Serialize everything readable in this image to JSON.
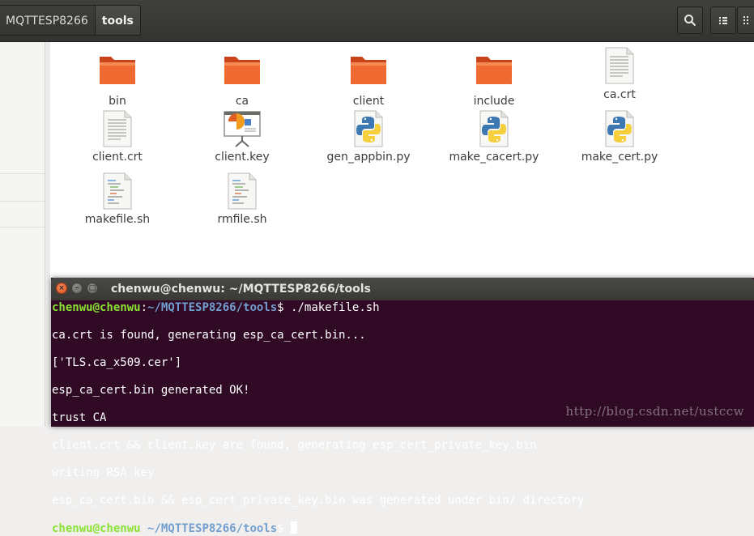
{
  "breadcrumbs": [
    "MQTTESP8266",
    "tools"
  ],
  "header_buttons": [
    "search-icon",
    "list-view-icon",
    "grid-view-icon"
  ],
  "files": [
    {
      "name": "bin",
      "type": "folder"
    },
    {
      "name": "ca",
      "type": "folder"
    },
    {
      "name": "client",
      "type": "folder"
    },
    {
      "name": "include",
      "type": "folder"
    },
    {
      "name": "ca.crt",
      "type": "text"
    },
    {
      "name": "client.crt",
      "type": "text"
    },
    {
      "name": "client.key",
      "type": "presentation"
    },
    {
      "name": "gen_appbin.py",
      "type": "python"
    },
    {
      "name": "make_cacert.py",
      "type": "python"
    },
    {
      "name": "make_cert.py",
      "type": "python"
    },
    {
      "name": "makefile.sh",
      "type": "script"
    },
    {
      "name": "rmfile.sh",
      "type": "script"
    }
  ],
  "terminal": {
    "title": "chenwu@chenwu: ~/MQTTESP8266/tools",
    "prompt_user": "chenwu@chenwu",
    "prompt_path": "~/MQTTESP8266/tools",
    "prompt_suffix": "$ ",
    "command": "./makefile.sh",
    "output": [
      "ca.crt is found, generating esp_ca_cert.bin...",
      "['TLS.ca_x509.cer']",
      "esp_ca_cert.bin generated OK!",
      "trust CA",
      "client.crt && client.key are found, generating esp_cert_private_key.bin",
      "writing RSA key",
      "esp_ca_cert.bin && esp_cert_private_key.bin was generated under bin/ directory"
    ]
  },
  "watermark": "http://blog.csdn.net/ustccw",
  "colors": {
    "folder": "#e95420",
    "terminal_bg": "#300a24",
    "prompt_user": "#8ae234",
    "prompt_path": "#729fcf"
  }
}
